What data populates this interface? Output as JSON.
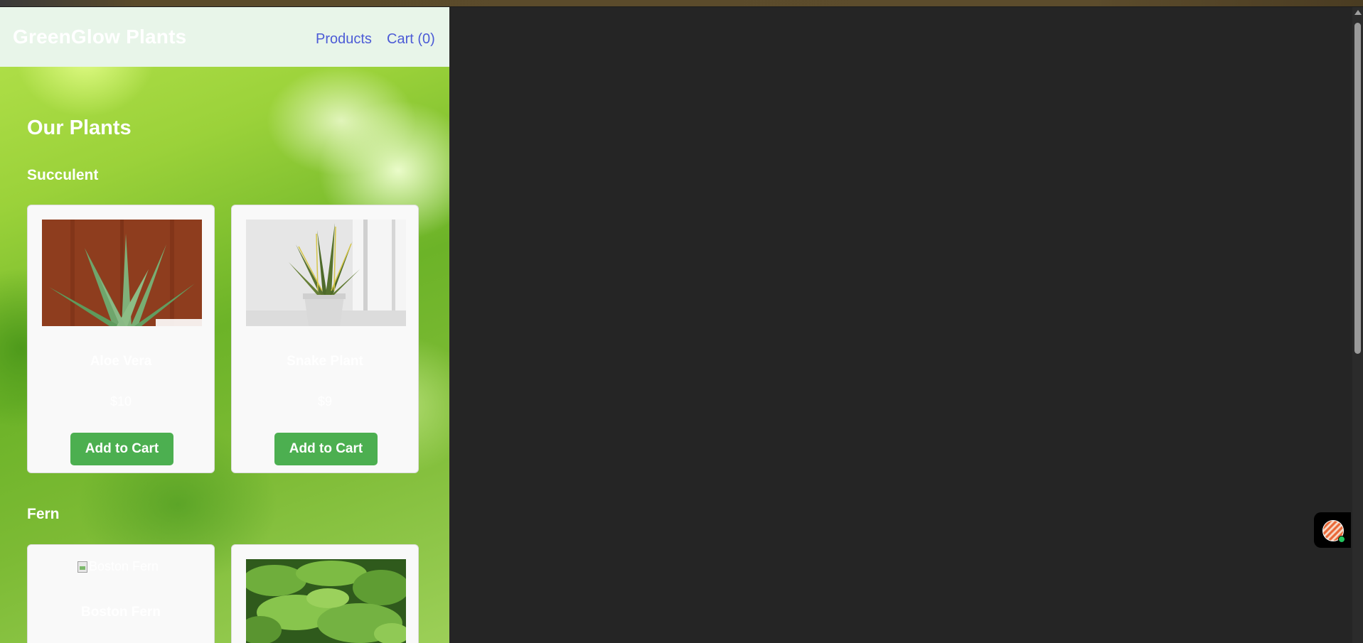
{
  "header": {
    "logo": "GreenGlow Plants",
    "nav": {
      "products": "Products",
      "cart": "Cart (0)"
    }
  },
  "main": {
    "title": "Our Plants",
    "categories": [
      {
        "name": "Succulent",
        "products": [
          {
            "name": "Aloe Vera",
            "price": "$10",
            "image_alt": "Aloe Vera",
            "button": "Add to Cart"
          },
          {
            "name": "Snake Plant",
            "price": "$9",
            "image_alt": "Snake Plant",
            "button": "Add to Cart"
          }
        ]
      },
      {
        "name": "Fern",
        "products": [
          {
            "name": "Boston Fern",
            "image_alt": "Boston Fern"
          },
          {
            "name": "",
            "image_alt": "Maidenhair Fern"
          }
        ]
      }
    ]
  },
  "colors": {
    "header_bg": "#e8f5e9",
    "nav_link": "#4c5bd6",
    "button_bg": "#4caf50",
    "card_bg": "#f9f9f9",
    "page_dark": "#252525"
  },
  "icons": {
    "chat": "chat-avatar-icon",
    "online": "online-status-dot-icon",
    "broken_image": "broken-image-icon"
  }
}
